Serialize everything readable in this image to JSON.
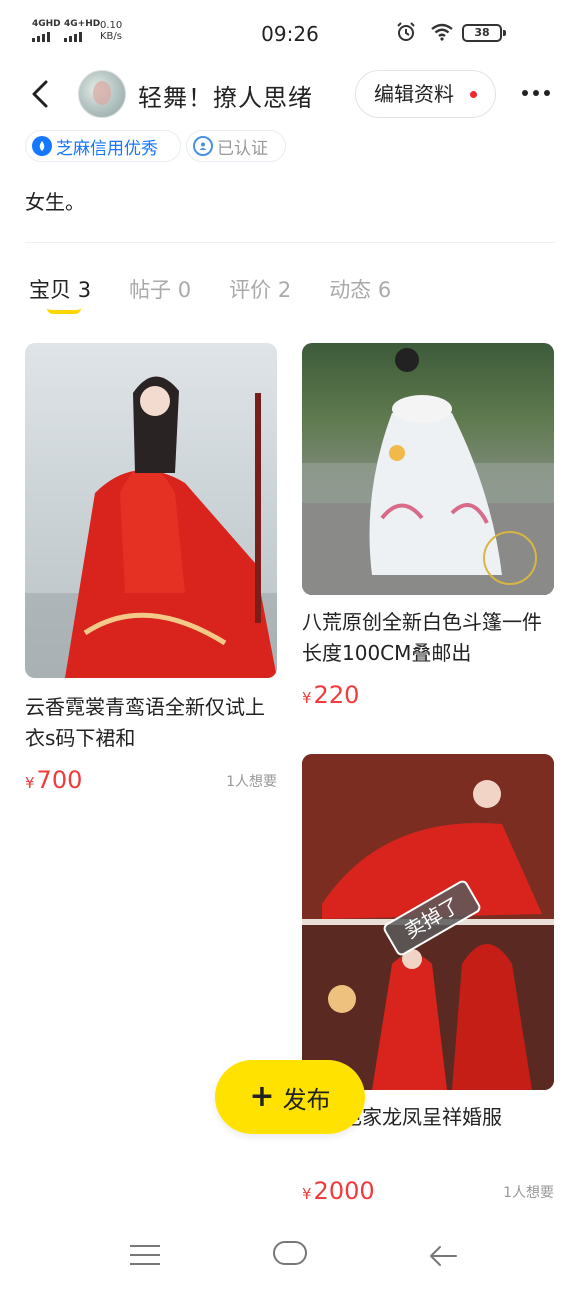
{
  "status_bar": {
    "sig1": "4GHD",
    "sig2": "4G+HD",
    "net_speed": "0.10",
    "net_unit": "KB/s",
    "time": "09:26",
    "battery": "38"
  },
  "header": {
    "nickname": "轻舞！撩人思绪",
    "edit_label": "编辑资料"
  },
  "badges": {
    "credit": "芝麻信用优秀",
    "verified": "已认证"
  },
  "bio": "女生。",
  "tabs": [
    {
      "label": "宝贝",
      "count": "3"
    },
    {
      "label": "帖子",
      "count": "0"
    },
    {
      "label": "评价",
      "count": "2"
    },
    {
      "label": "动态",
      "count": "6"
    }
  ],
  "items": [
    {
      "title": "云香霓裳青鸾语全新仅试上衣s码下裙和",
      "currency": "¥",
      "price": "700",
      "wants": "1人想要"
    },
    {
      "title": "八荒原创全新白色斗篷一件长度100CM叠邮出",
      "currency": "¥",
      "price": "220"
    },
    {
      "title": "婚秋色家龙凤呈祥婚服",
      "currency": "¥",
      "price": "2000",
      "wants": "1人想要",
      "sold_tag": "卖掉了"
    }
  ],
  "fab_label": "发布",
  "colors": {
    "accent_yellow": "#ffe200",
    "price_red": "#f23a3a",
    "credit_blue": "#1677ff"
  }
}
